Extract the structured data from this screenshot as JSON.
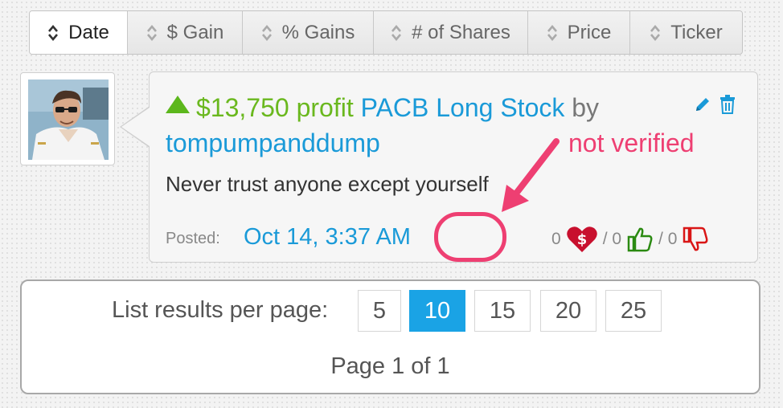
{
  "sort_tabs": [
    {
      "label": "Date",
      "active": true
    },
    {
      "label": "$ Gain",
      "active": false
    },
    {
      "label": "% Gains",
      "active": false
    },
    {
      "label": "# of Shares",
      "active": false
    },
    {
      "label": "Price",
      "active": false
    },
    {
      "label": "Ticker",
      "active": false
    }
  ],
  "post": {
    "amount": "$13,750 profit",
    "trade": "PACB Long Stock",
    "by": "by",
    "user": "tompumpanddump",
    "message": "Never trust anyone except yourself",
    "posted_label": "Posted:",
    "posted_date": "Oct 14, 3:37 AM",
    "hearts": "0",
    "sep1": "/ 0",
    "sep2": "/ 0",
    "icons": [
      "edit-icon",
      "trash-icon",
      "heart-dollar-icon",
      "thumbs-up-icon",
      "thumbs-down-icon"
    ]
  },
  "annotation": {
    "text": "not verified",
    "color": "#ee3f72"
  },
  "pager": {
    "label": "List results per page:",
    "options": [
      "5",
      "10",
      "15",
      "20",
      "25"
    ],
    "selected": "10",
    "status": "Page 1 of 1"
  },
  "colors": {
    "profit_green": "#6ab81e",
    "link_blue": "#1a9ad8",
    "active_page": "#1aa3e5"
  }
}
